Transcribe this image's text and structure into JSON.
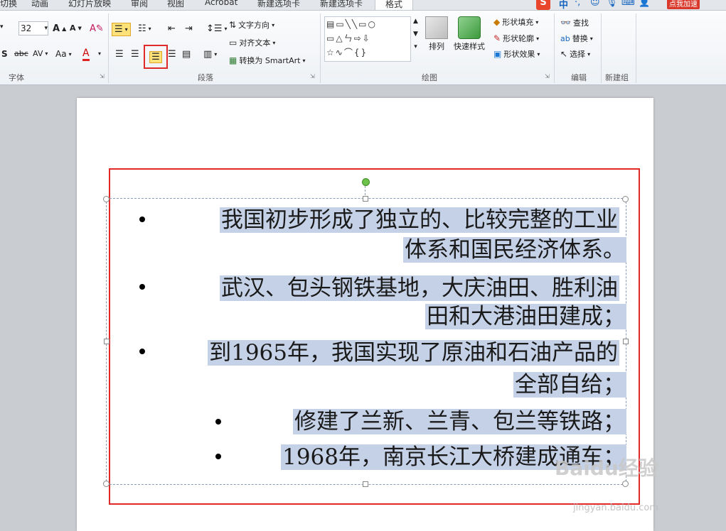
{
  "tabs": [
    "切换",
    "动画",
    "幻灯片放映",
    "审阅",
    "视图",
    "Acrobat",
    "新建选项卡",
    "新建选项卡",
    "格式"
  ],
  "font": {
    "size": "32",
    "label": "字体"
  },
  "paragraph": {
    "label": "段落",
    "text_direction": "文字方向",
    "align_text": "对齐文本",
    "smartart": "转换为 SmartArt"
  },
  "drawing": {
    "label": "绘图",
    "arrange": "排列",
    "quick_styles": "快速样式",
    "shape_fill": "形状填充",
    "shape_outline": "形状轮廓",
    "shape_effects": "形状效果"
  },
  "editing": {
    "label": "编辑",
    "find": "查找",
    "replace": "替换",
    "select": "选择"
  },
  "newgroup": {
    "label": "新建组"
  },
  "ime": {
    "lang": "中",
    "badge": "点我加速"
  },
  "slide": {
    "lines": [
      "我国初步形成了独立的、比较完整的工业",
      "体系和国民经济体系。",
      "武汉、包头钢铁基地，大庆油田、胜利油",
      "田和大港油田建成；",
      "到1965年，我国实现了原油和石油产品的",
      "全部自给；",
      "修建了兰新、兰青、包兰等铁路；",
      "1968年，南京长江大桥建成通车；"
    ]
  },
  "watermark": {
    "text": "Baidu经验",
    "url": "jingyan.baidu.com"
  }
}
